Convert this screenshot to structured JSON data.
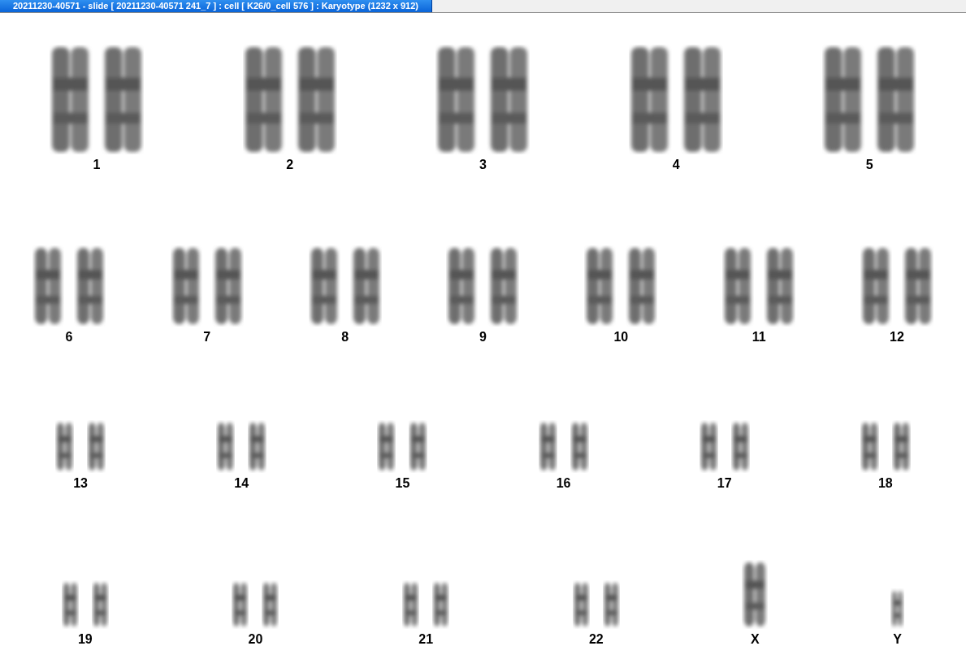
{
  "window": {
    "title": "20211230-40571 - slide [ 20211230-40571 241_7 ] : cell [ K26/0_cell 576 ] : Karyotype  (1232 x 912)"
  },
  "karyotype": {
    "rows": [
      {
        "items": [
          {
            "label": "1",
            "kind": "pair"
          },
          {
            "label": "2",
            "kind": "pair"
          },
          {
            "label": "3",
            "kind": "pair"
          },
          {
            "label": "4",
            "kind": "pair"
          },
          {
            "label": "5",
            "kind": "pair"
          }
        ]
      },
      {
        "items": [
          {
            "label": "6",
            "kind": "pair"
          },
          {
            "label": "7",
            "kind": "pair"
          },
          {
            "label": "8",
            "kind": "pair"
          },
          {
            "label": "9",
            "kind": "pair"
          },
          {
            "label": "10",
            "kind": "pair"
          },
          {
            "label": "11",
            "kind": "pair"
          },
          {
            "label": "12",
            "kind": "pair"
          }
        ]
      },
      {
        "items": [
          {
            "label": "13",
            "kind": "pair"
          },
          {
            "label": "14",
            "kind": "pair"
          },
          {
            "label": "15",
            "kind": "pair"
          },
          {
            "label": "16",
            "kind": "pair"
          },
          {
            "label": "17",
            "kind": "pair"
          },
          {
            "label": "18",
            "kind": "pair"
          }
        ]
      },
      {
        "items": [
          {
            "label": "19",
            "kind": "pair"
          },
          {
            "label": "20",
            "kind": "pair"
          },
          {
            "label": "21",
            "kind": "pair"
          },
          {
            "label": "22",
            "kind": "pair"
          },
          {
            "label": "X",
            "kind": "single"
          },
          {
            "label": "Y",
            "kind": "single"
          }
        ]
      }
    ]
  }
}
